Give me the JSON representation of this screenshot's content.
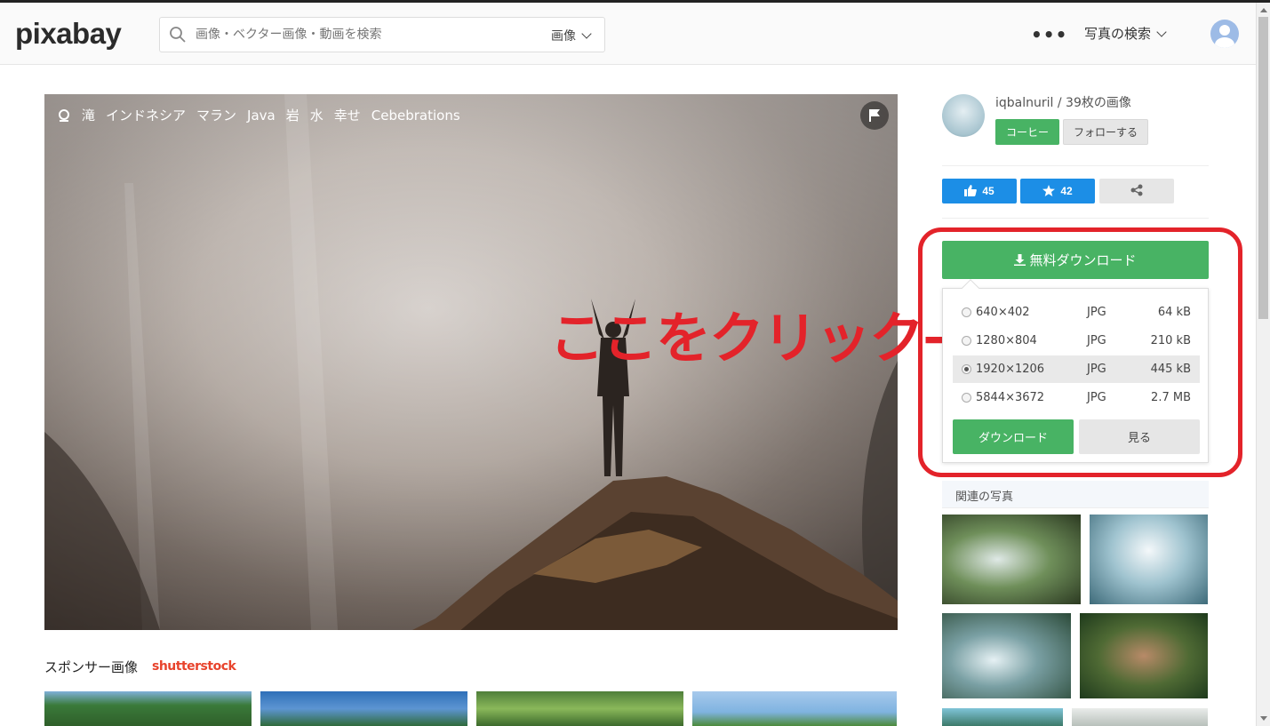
{
  "header": {
    "logo": "pixabay",
    "search_placeholder": "画像・ベクター画像・動画を検索",
    "search_type": "画像",
    "more": "•••",
    "explore": "写真の検索"
  },
  "image": {
    "tags": [
      "滝",
      "インドネシア",
      "マラン",
      "Java",
      "岩",
      "水",
      "幸せ",
      "Cebebrations"
    ]
  },
  "annotation": "ここをクリック→",
  "sponsor": {
    "label": "スポンサー画像",
    "brand": "shutterstock"
  },
  "user": {
    "name": "iqbalnuril / 39枚の画像",
    "coffee_label": "コーヒー",
    "follow_label": "フォローする"
  },
  "actions": {
    "likes": "45",
    "favorites": "42"
  },
  "download": {
    "main_label": "無料ダウンロード",
    "options": [
      {
        "size": "640×402",
        "format": "JPG",
        "filesize": "64 kB",
        "selected": false
      },
      {
        "size": "1280×804",
        "format": "JPG",
        "filesize": "210 kB",
        "selected": false
      },
      {
        "size": "1920×1206",
        "format": "JPG",
        "filesize": "445 kB",
        "selected": true
      },
      {
        "size": "5844×3672",
        "format": "JPG",
        "filesize": "2.7 MB",
        "selected": false
      }
    ],
    "download_label": "ダウンロード",
    "view_label": "見る"
  },
  "related": {
    "title": "関連の写真"
  },
  "colors": {
    "green": "#48b364",
    "blue": "#1c8ee6",
    "annotation_red": "#e3232a"
  }
}
